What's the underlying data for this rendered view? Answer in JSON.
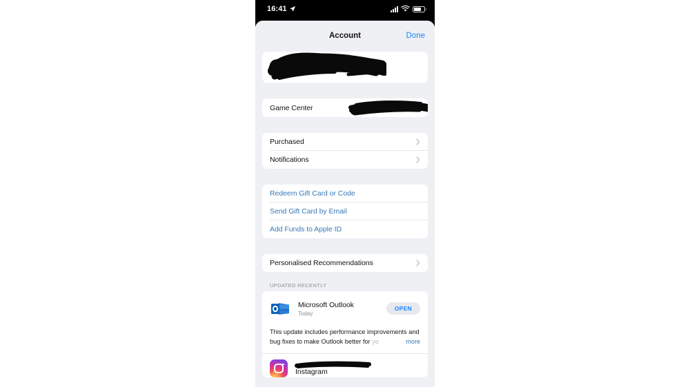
{
  "statusbar": {
    "time": "16:41",
    "location_icon": "location-arrow-icon",
    "cellular_icon": "cellular-signal-icon",
    "wifi_icon": "wifi-icon",
    "battery_icon": "battery-icon"
  },
  "navbar": {
    "title": "Account",
    "done_label": "Done"
  },
  "account": {
    "apple_id_redacted": "",
    "game_center_label": "Game Center",
    "game_center_value_redacted": ""
  },
  "menu": {
    "items": [
      {
        "label": "Purchased",
        "chevron": "chevron-right-icon"
      },
      {
        "label": "Notifications",
        "chevron": "chevron-right-icon"
      }
    ]
  },
  "giftcards": {
    "items": [
      {
        "label": "Redeem Gift Card or Code"
      },
      {
        "label": "Send Gift Card by Email"
      },
      {
        "label": "Add Funds to Apple ID"
      }
    ]
  },
  "recommendations": {
    "label": "Personalised Recommendations",
    "chevron": "chevron-right-icon"
  },
  "updated": {
    "section_header": "UPDATED RECENTLY",
    "apps": [
      {
        "name": "Microsoft Outlook",
        "subtitle": "Today",
        "action_label": "OPEN",
        "icon": "microsoft-outlook-icon",
        "description_line1": "This update includes performance improvements",
        "description_line2": "and bug fixes to make Outlook better for",
        "description_tail": "yo",
        "more_label": "more"
      },
      {
        "name": "Instagram",
        "icon": "instagram-icon",
        "name_redacted": ""
      }
    ]
  },
  "colors": {
    "accent_blue": "#1b84ff",
    "link_blue": "#3879b7",
    "sheet_bg": "#eff0f4",
    "card_bg": "#ffffff",
    "separator": "#e6e6e8",
    "muted_text": "#8d8d92",
    "redaction": "#080808"
  }
}
